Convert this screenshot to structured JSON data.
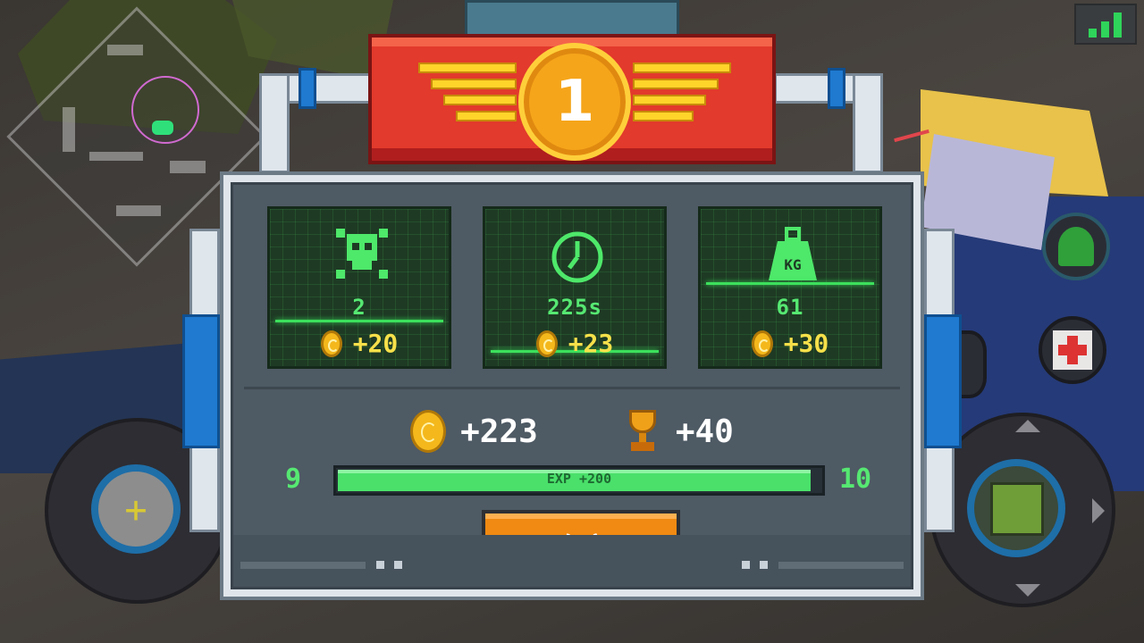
{
  "hud": {
    "signal_icon": "signal-bars-icon",
    "minimap_label": "minimap"
  },
  "result": {
    "rank": "1",
    "stats": [
      {
        "icon": "skull-icon",
        "value": "2",
        "reward": "+20"
      },
      {
        "icon": "clock-icon",
        "value": "225s",
        "reward": "+23"
      },
      {
        "icon": "weight-icon",
        "value": "61",
        "reward": "+30",
        "icon_text": "KG"
      }
    ],
    "total_coins": "+223",
    "total_trophies": "+40",
    "level_current": "9",
    "level_next": "10",
    "exp_label": "EXP +200",
    "exp_progress": 0.98,
    "confirm_label": "确定"
  },
  "colors": {
    "accent_green": "#56e872",
    "coin_yellow": "#f4b81c",
    "button_orange": "#f08a12",
    "banner_red": "#e23a2c"
  }
}
